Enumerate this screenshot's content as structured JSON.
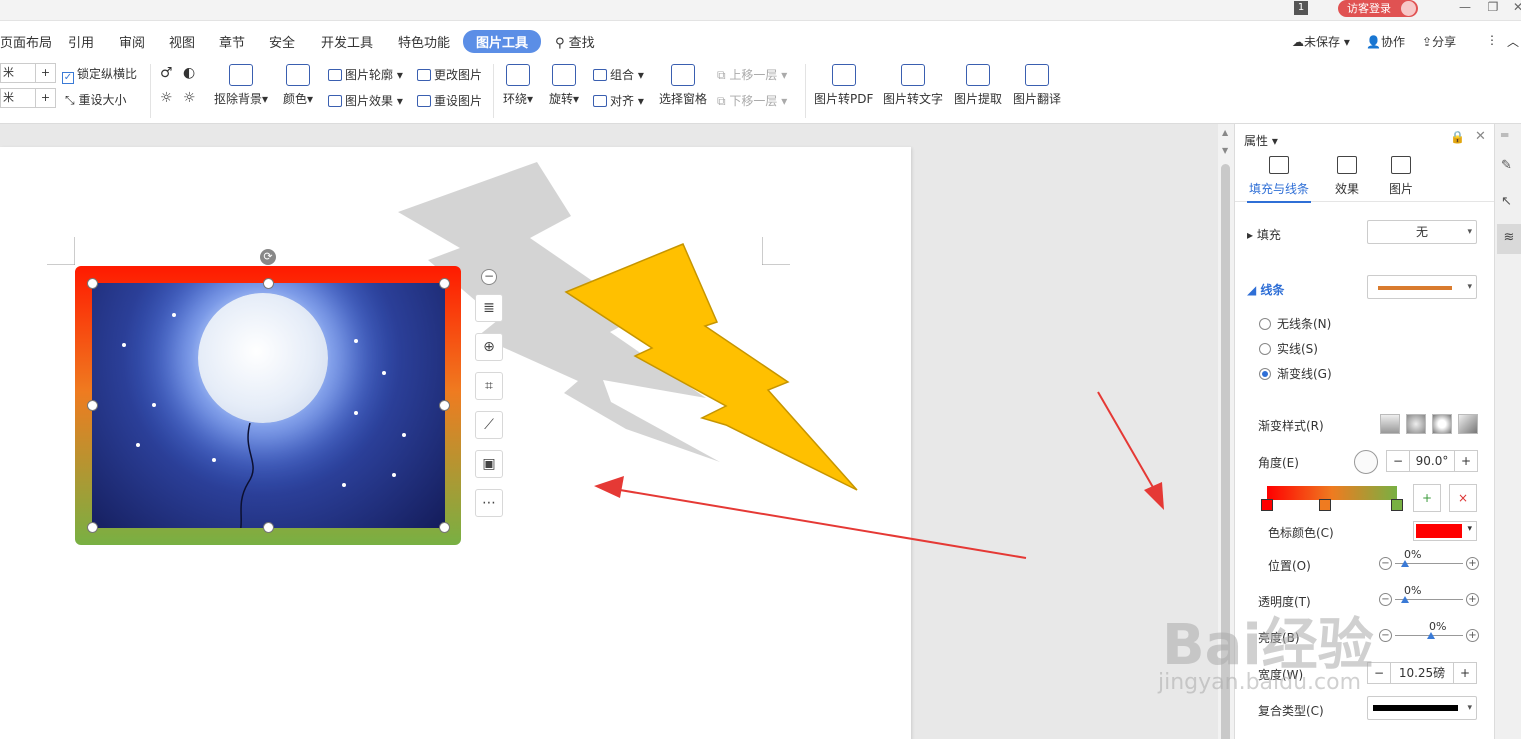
{
  "topbar": {
    "page_number": "1",
    "login_label": "访客登录"
  },
  "menu": {
    "items": [
      "页面布局",
      "引用",
      "审阅",
      "视图",
      "章节",
      "安全",
      "开发工具",
      "特色功能",
      "图片工具"
    ],
    "active": "图片工具",
    "search": "查找",
    "unsaved": "未保存",
    "collab": "协作",
    "share": "分享"
  },
  "ribbon": {
    "unit_1": "米",
    "unit_2": "米",
    "lock_ratio": "锁定纵横比",
    "reset_size": "重设大小",
    "remove_bg": "抠除背景",
    "color": "颜色",
    "outline": "图片轮廓",
    "effect": "图片效果",
    "change_pic": "更改图片",
    "reset_pic": "重设图片",
    "wrap": "环绕",
    "rotate": "旋转",
    "group": "组合",
    "align": "对齐",
    "select_pane": "选择窗格",
    "bring_forward": "上移一层",
    "send_backward": "下移一层",
    "to_pdf": "图片转PDF",
    "to_text": "图片转文字",
    "extract": "图片提取",
    "translate": "图片翻译"
  },
  "panel": {
    "title": "属性",
    "tabs": [
      "填充与线条",
      "效果",
      "图片"
    ],
    "fill_label": "填充",
    "fill_value": "无",
    "line_label": "线条",
    "no_line": "无线条(N)",
    "solid_line": "实线(S)",
    "gradient_line": "渐变线(G)",
    "gradient_style": "渐变样式(R)",
    "angle_label": "角度(E)",
    "angle_value": "90.0°",
    "stop_color_label": "色标颜色(C)",
    "position_label": "位置(O)",
    "position_value": "0%",
    "transparency_label": "透明度(T)",
    "transparency_value": "0%",
    "brightness_label": "亮度(B)",
    "brightness_value": "0%",
    "width_label": "宽度(W)",
    "width_value": "10.25磅",
    "compound_label": "复合类型(C)"
  },
  "colors": {
    "accent": "#5b8ee6",
    "stop_color": "#ff0000",
    "lightning": "#ffc000",
    "arrow": "#e53935"
  },
  "watermark": {
    "main": "Bai经验",
    "sub": "jingyan.baidu.com"
  }
}
